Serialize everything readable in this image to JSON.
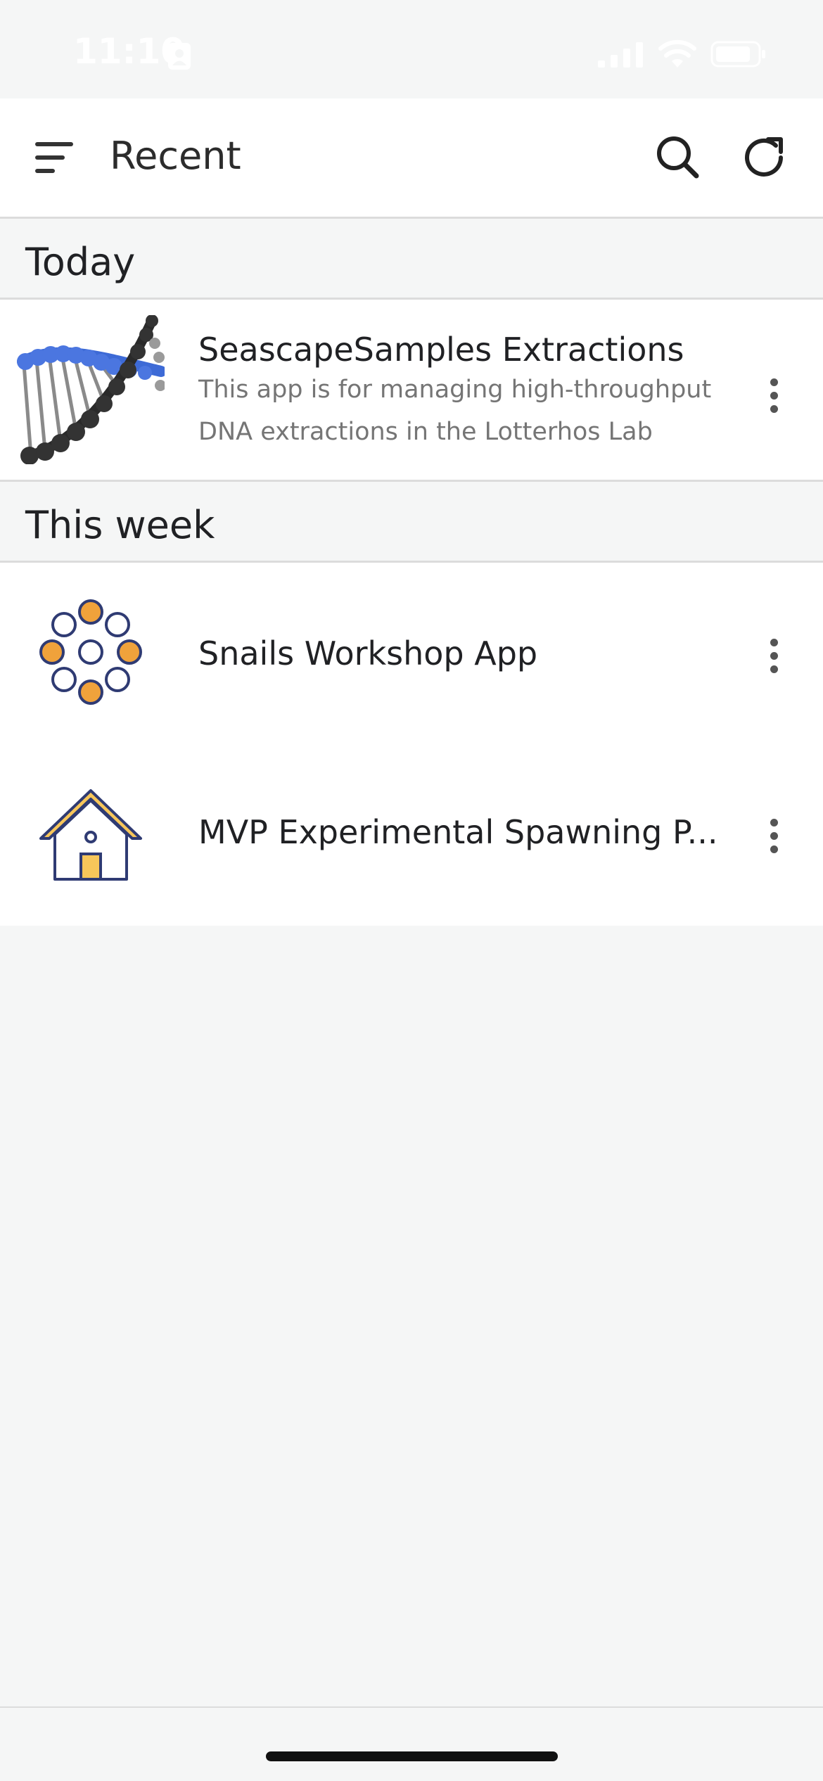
{
  "status_bar": {
    "time": "11:10",
    "person_icon": "person-badge-icon",
    "signal_icon": "cellular-signal-icon",
    "wifi_icon": "wifi-icon",
    "battery_icon": "battery-icon"
  },
  "app_bar": {
    "title": "Recent",
    "menu_icon": "sort-menu-icon",
    "search_icon": "search-icon",
    "refresh_icon": "refresh-icon"
  },
  "sections": [
    {
      "header": "Today",
      "items": [
        {
          "title": "SeascapeSamples Extractions",
          "description": "This app is for managing high-throughput DNA extractions in the Lotterhos Lab",
          "thumbnail_icon": "dna-helix-image"
        }
      ]
    },
    {
      "header": "This week",
      "items": [
        {
          "title": "Snails Workshop App",
          "description": "",
          "thumbnail_icon": "circle-dots-icon"
        },
        {
          "title": "MVP Experimental Spawning P...",
          "description": "",
          "thumbnail_icon": "house-icon"
        }
      ]
    }
  ],
  "colors": {
    "accent_orange": "#f0a23b",
    "icon_navy": "#2f3b73",
    "house_yellow": "#f7c65a",
    "background": "#f5f6f6"
  }
}
